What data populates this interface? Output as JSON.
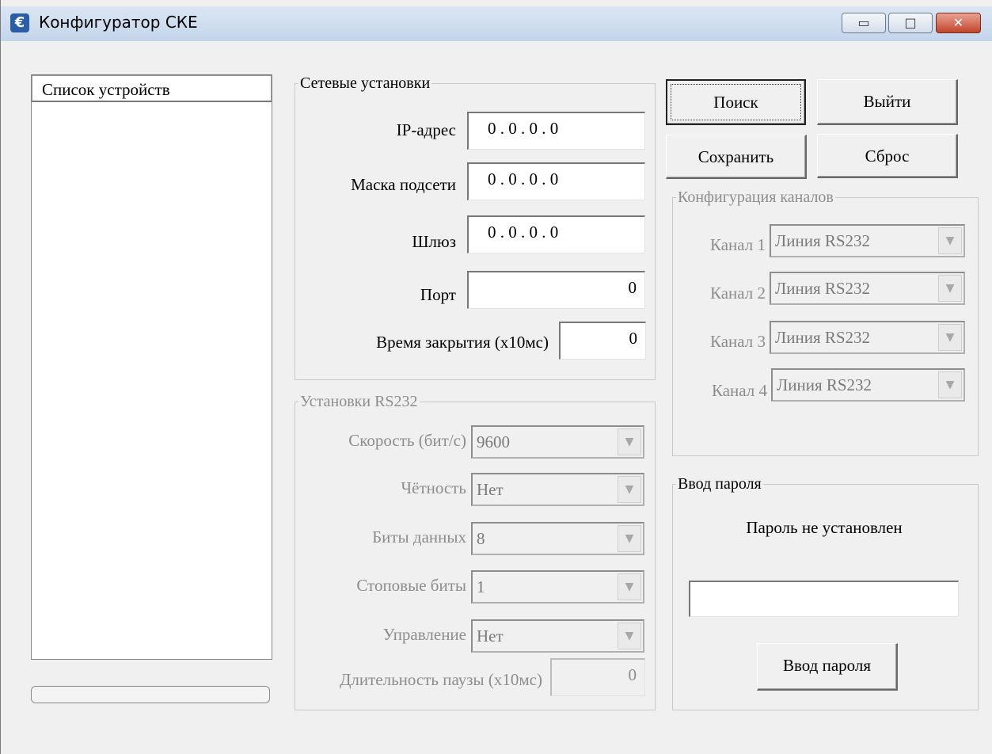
{
  "window": {
    "title": "Конфигуратор СКЕ",
    "app_icon_glyph": "€",
    "controls": {
      "minimize": "▭",
      "maximize": "□",
      "close": "✕"
    }
  },
  "device_list": {
    "header": "Список устройств",
    "items": []
  },
  "progress": {
    "value": 0
  },
  "network": {
    "legend": "Сетевые установки",
    "ip_label": "IP-адрес",
    "ip_value": "0 . 0 . 0 . 0",
    "mask_label": "Маска подсети",
    "mask_value": "0 . 0 . 0 . 0",
    "gateway_label": "Шлюз",
    "gateway_value": "0 . 0 . 0 . 0",
    "port_label": "Порт",
    "port_value": "0",
    "close_time_label": "Время закрытия (x10мс)",
    "close_time_value": "0"
  },
  "rs232": {
    "legend": "Установки RS232",
    "speed_label": "Скорость (бит/с)",
    "speed_value": "9600",
    "parity_label": "Чётность",
    "parity_value": "Нет",
    "databits_label": "Биты данных",
    "databits_value": "8",
    "stopbits_label": "Стоповые биты",
    "stopbits_value": "1",
    "flow_label": "Управление",
    "flow_value": "Нет",
    "pause_label": "Длительность паузы (x10мс)",
    "pause_value": "0"
  },
  "buttons": {
    "search": "Поиск",
    "exit": "Выйти",
    "save": "Сохранить",
    "reset": "Сброс"
  },
  "channels": {
    "legend": "Конфигурация каналов",
    "items": [
      {
        "label": "Канал 1",
        "value": "Линия RS232"
      },
      {
        "label": "Канал 2",
        "value": "Линия RS232"
      },
      {
        "label": "Канал 3",
        "value": "Линия RS232"
      },
      {
        "label": "Канал 4",
        "value": "Линия RS232"
      }
    ]
  },
  "password": {
    "legend": "Ввод пароля",
    "status": "Пароль не установлен",
    "input_value": "",
    "button": "Ввод пароля"
  },
  "colors": {
    "titlebar": "#c4d5ea",
    "close_button": "#c2452d",
    "disabled_text": "#8d8d8d"
  }
}
